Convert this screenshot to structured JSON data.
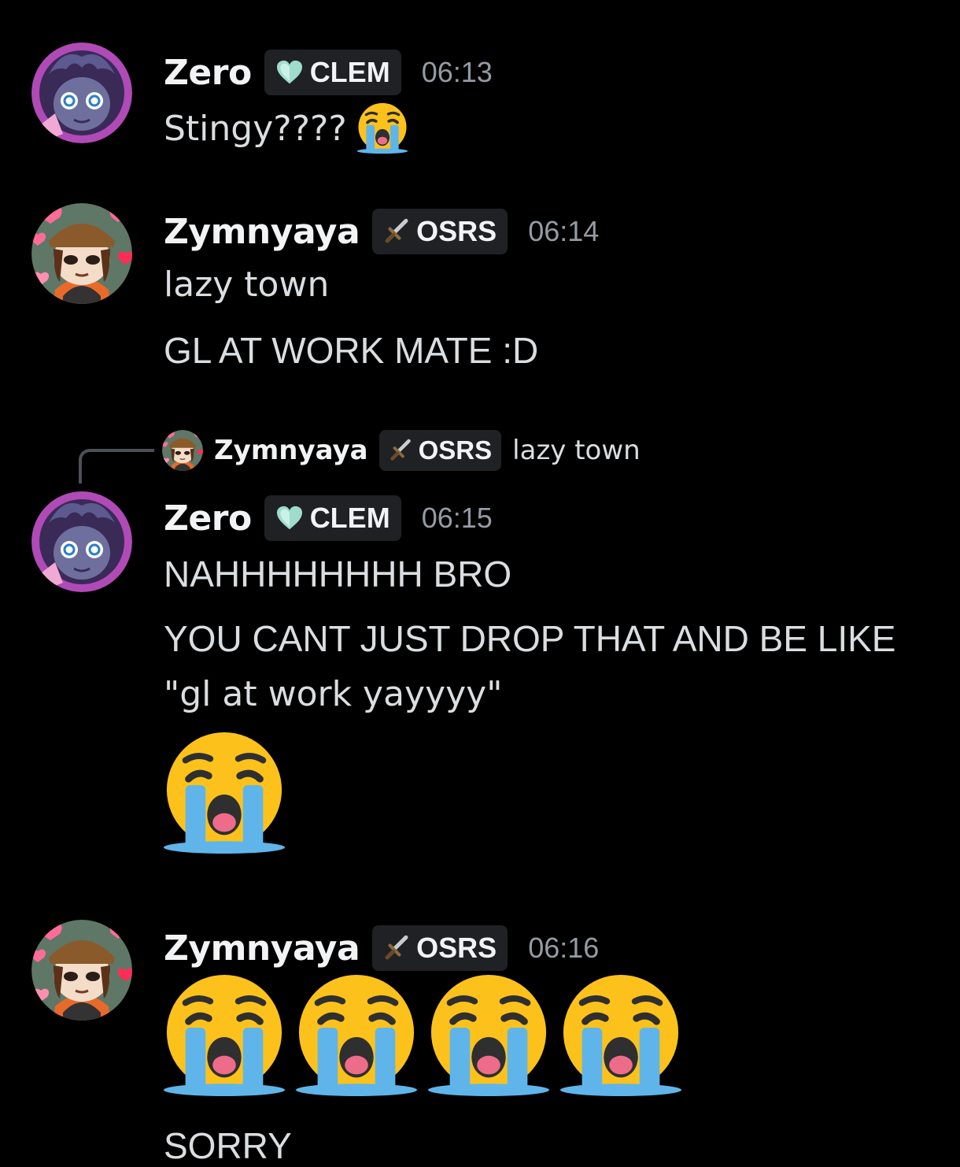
{
  "messages": [
    {
      "author": "Zero",
      "tag_label": "CLEM",
      "tag_icon": "heart-gem-icon",
      "time": "06:13",
      "lines": [
        "Stingy????"
      ],
      "trailing_emoji": "loudly-crying-face-emoji"
    },
    {
      "author": "Zymnyaya",
      "tag_label": "OSRS",
      "tag_icon": "sword-icon",
      "time": "06:14",
      "lines": [
        "lazy town",
        "GL AT WORK MATE :D"
      ]
    },
    {
      "reply_to": {
        "author": "Zymnyaya",
        "tag_label": "OSRS",
        "text": "lazy town"
      },
      "author": "Zero",
      "tag_label": "CLEM",
      "time": "06:15",
      "lines": [
        "NAHHHHHHHH BRO",
        "YOU CANT JUST DROP THAT AND BE LIKE",
        "\"gl at work yayyyy\""
      ],
      "jumbo_emoji_count": 1
    },
    {
      "author": "Zymnyaya",
      "tag_label": "OSRS",
      "time": "06:16",
      "jumbo_emoji_count": 4,
      "lines": [
        "SORRY"
      ]
    }
  ],
  "colors": {
    "background": "#000000",
    "username": "#f2f3f5",
    "text": "#dbdee1",
    "timestamp": "#949ba4",
    "tag_bg": "#1f2124"
  }
}
